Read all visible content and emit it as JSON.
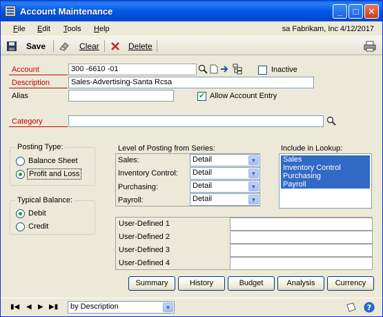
{
  "window": {
    "title": "Account Maintenance",
    "minimize": "_",
    "maximize": "□",
    "close": "✕"
  },
  "menu": {
    "items": [
      {
        "label": "File",
        "mnemonic": "F",
        "rest": "ile"
      },
      {
        "label": "Edit",
        "mnemonic": "E",
        "rest": "dit"
      },
      {
        "label": "Tools",
        "mnemonic": "T",
        "rest": "ools"
      },
      {
        "label": "Help",
        "mnemonic": "H",
        "rest": "elp"
      }
    ],
    "context": "sa  Fabrikam, Inc  4/12/2017"
  },
  "toolbar": {
    "save_label": "Save",
    "clear_label": "Clear",
    "delete_label": "Delete"
  },
  "form": {
    "account_label": "Account",
    "account_value": "300 -6610 -01",
    "inactive_label": "Inactive",
    "inactive_checked": false,
    "description_label": "Description",
    "description_value": "Sales-Advertising-Santa Rcsa",
    "alias_label": "Alias",
    "alias_value": "",
    "allow_entry_label": "Allow Account Entry",
    "allow_entry_checked": true,
    "category_label": "Category",
    "category_value": ""
  },
  "posting_type": {
    "title": "Posting Type:",
    "options": [
      "Balance Sheet",
      "Profit and Loss"
    ],
    "selected": "Profit and Loss"
  },
  "typical_balance": {
    "title": "Typical Balance:",
    "options": [
      "Debit",
      "Credit"
    ],
    "selected": "Debit"
  },
  "level_of_posting": {
    "title": "Level of Posting from Series:",
    "rows": [
      {
        "label": "Sales:",
        "value": "Detail"
      },
      {
        "label": "Inventory Control:",
        "value": "Detail"
      },
      {
        "label": "Purchasing:",
        "value": "Detail"
      },
      {
        "label": "Payroll:",
        "value": "Detail"
      }
    ]
  },
  "include_in_lookup": {
    "title": "Include in Lookup:",
    "items": [
      "Sales",
      "Inventory Control",
      "Purchasing",
      "Payroll"
    ]
  },
  "user_defined": [
    {
      "label": "User-Defined 1",
      "value": ""
    },
    {
      "label": "User-Defined 2",
      "value": ""
    },
    {
      "label": "User-Defined 3",
      "value": ""
    },
    {
      "label": "User-Defined 4",
      "value": ""
    }
  ],
  "buttons": {
    "summary": "Summary",
    "history": "History",
    "budget": "Budget",
    "analysis": "Analysis",
    "currency": "Currency"
  },
  "statusbar": {
    "sort_value": "by Description"
  }
}
